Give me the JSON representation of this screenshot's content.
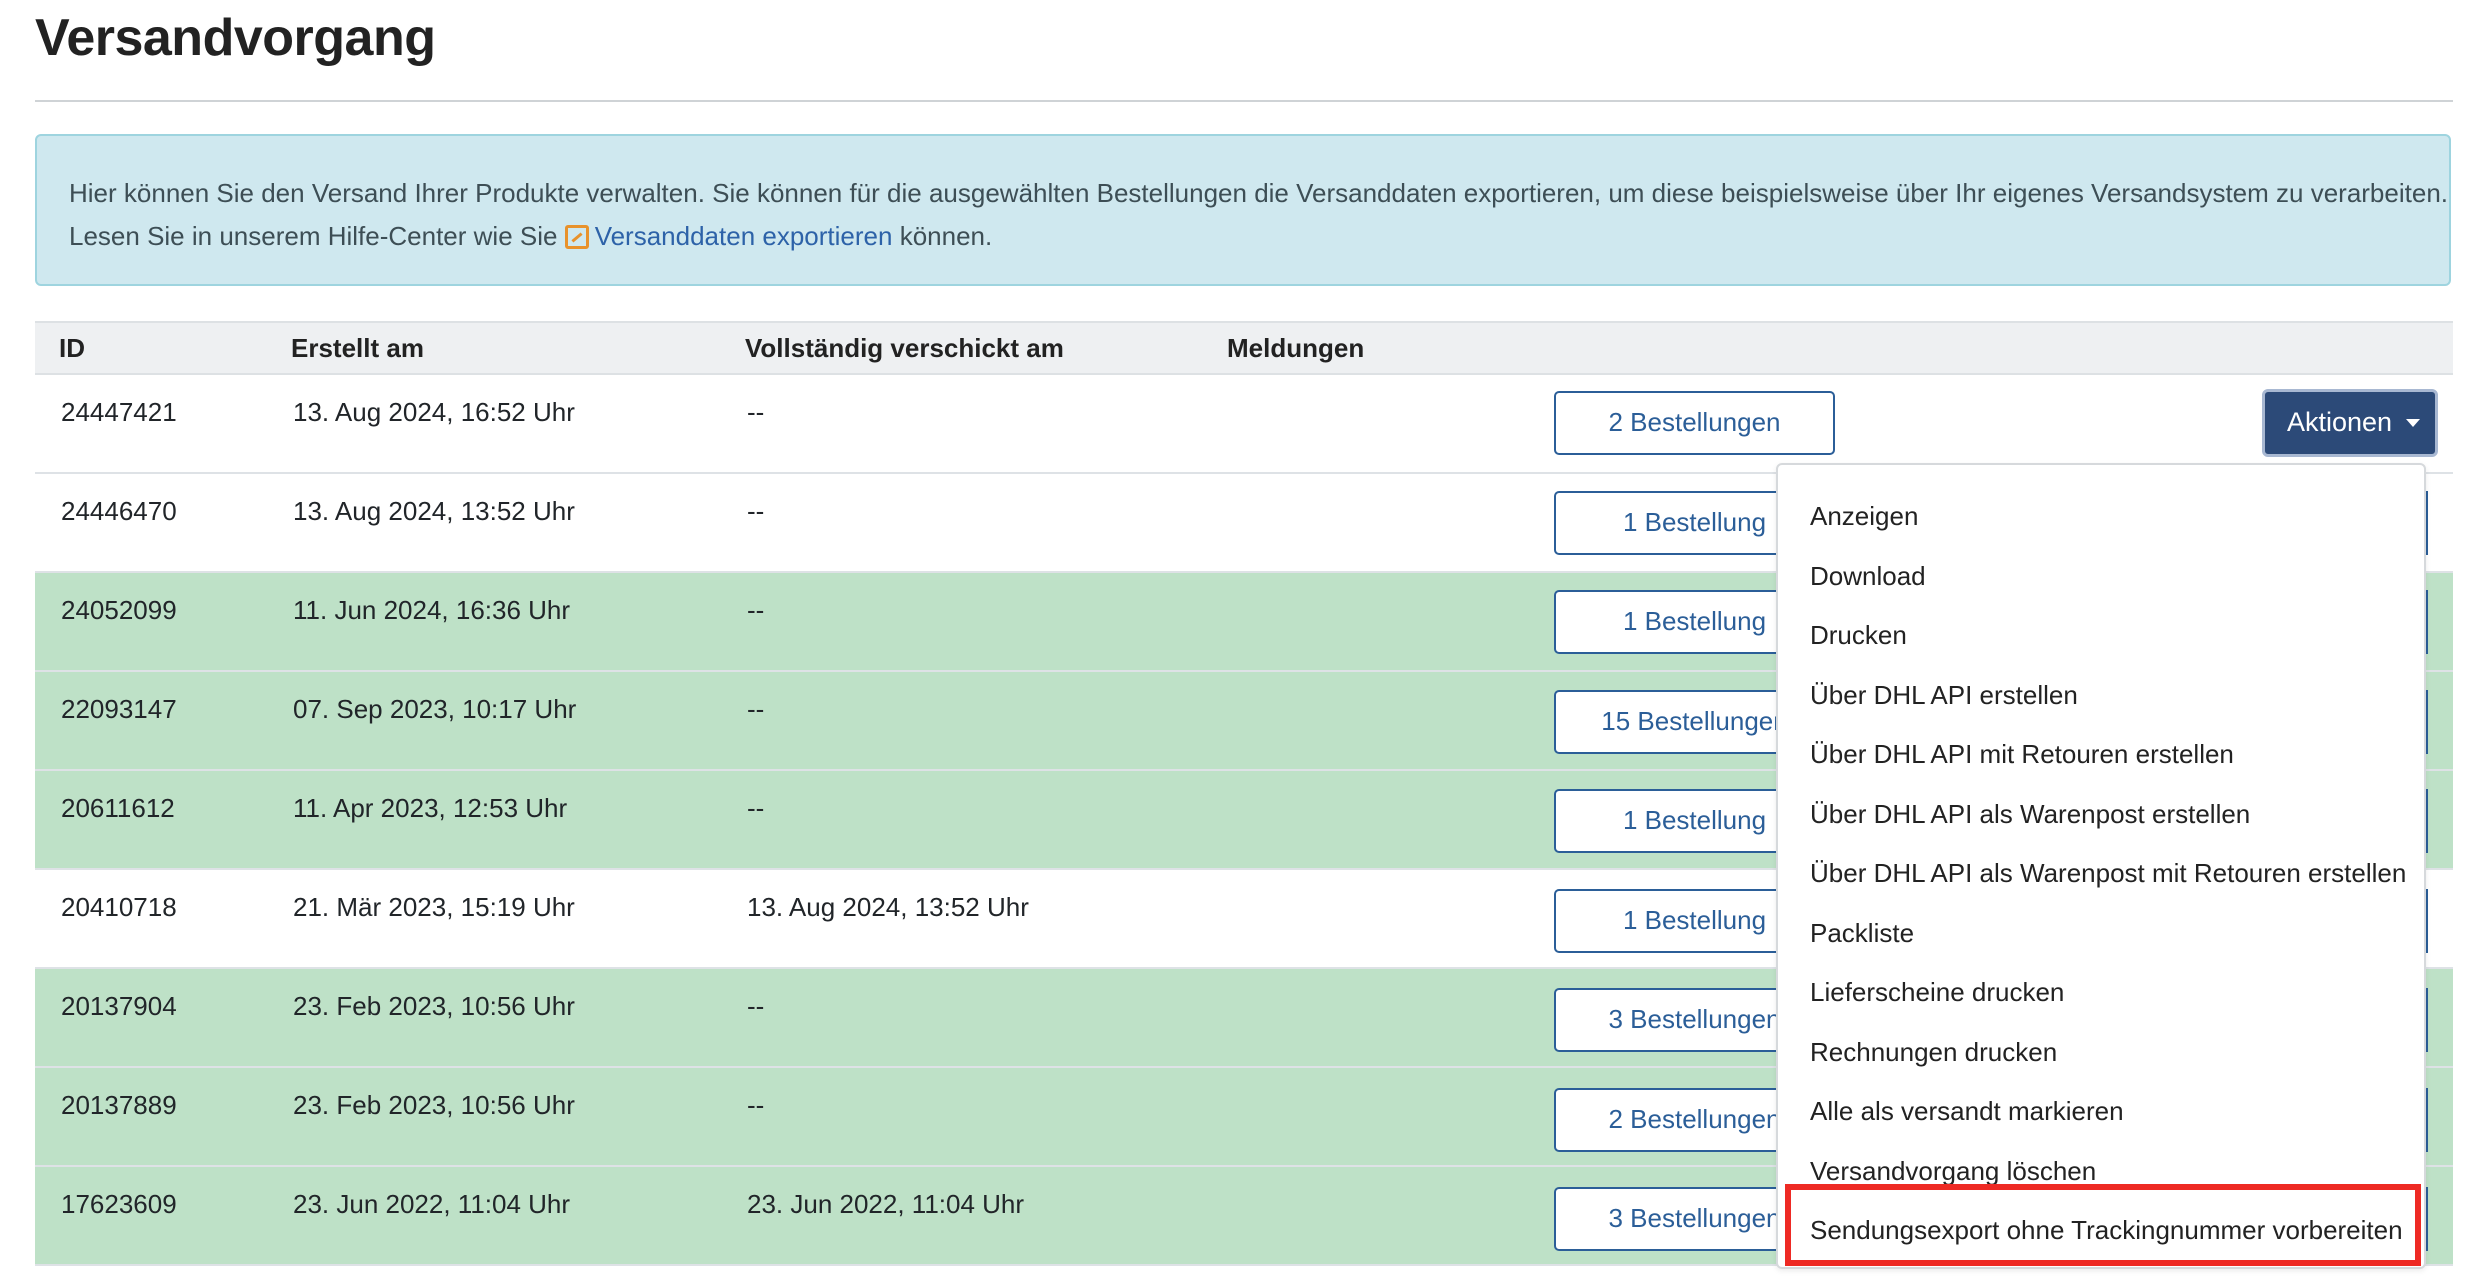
{
  "page_title": "Versandvorgang",
  "info": {
    "text_part1": "Hier können Sie den Versand Ihrer Produkte verwalten. Sie können für die ausgewählten Bestellungen die Versanddaten exportieren, um diese beispielsweise über Ihr eigenes Versandsystem zu verarbeiten.",
    "text_part2_prefix": "Lesen Sie in unserem Hilfe-Center wie Sie",
    "link_label": "Versanddaten exportieren",
    "text_part2_suffix": "können.",
    "link_icon": "export-icon"
  },
  "table": {
    "headers": [
      "ID",
      "Erstellt am",
      "Vollständig verschickt am",
      "Meldungen"
    ],
    "rows": [
      {
        "id": "24447421",
        "created": "13. Aug 2024, 16:52 Uhr",
        "shipped": "--",
        "orders": "2 Bestellungen",
        "highlight": false
      },
      {
        "id": "24446470",
        "created": "13. Aug 2024, 13:52 Uhr",
        "shipped": "--",
        "orders": "1 Bestellung",
        "highlight": false
      },
      {
        "id": "24052099",
        "created": "11. Jun 2024, 16:36 Uhr",
        "shipped": "--",
        "orders": "1 Bestellung",
        "highlight": true
      },
      {
        "id": "22093147",
        "created": "07. Sep 2023, 10:17 Uhr",
        "shipped": "--",
        "orders": "15 Bestellungen",
        "highlight": true
      },
      {
        "id": "20611612",
        "created": "11. Apr 2023, 12:53 Uhr",
        "shipped": "--",
        "orders": "1 Bestellung",
        "highlight": true
      },
      {
        "id": "20410718",
        "created": "21. Mär 2023, 15:19 Uhr",
        "shipped": "13. Aug 2024, 13:52 Uhr",
        "orders": "1 Bestellung",
        "highlight": false
      },
      {
        "id": "20137904",
        "created": "23. Feb 2023, 10:56 Uhr",
        "shipped": "--",
        "orders": "3 Bestellungen",
        "highlight": true
      },
      {
        "id": "20137889",
        "created": "23. Feb 2023, 10:56 Uhr",
        "shipped": "--",
        "orders": "2 Bestellungen",
        "highlight": true
      },
      {
        "id": "17623609",
        "created": "23. Jun 2022, 11:04 Uhr",
        "shipped": "23. Jun 2022, 11:04 Uhr",
        "orders": "3 Bestellungen",
        "highlight": true
      }
    ]
  },
  "actions_button": "Aktionen",
  "dropdown_items": [
    "Anzeigen",
    "Download",
    "Drucken",
    "Über DHL API erstellen",
    "Über DHL API mit Retouren erstellen",
    "Über DHL API als Warenpost erstellen",
    "Über DHL API als Warenpost mit Retouren erstellen",
    "Packliste",
    "Lieferscheine drucken",
    "Rechnungen drucken",
    "Alle als versandt markieren",
    "Versandvorgang löschen",
    "Sendungsexport ohne Trackingnummer vorbereiten"
  ],
  "colors": {
    "info_bg": "#cfe8ef",
    "row_highlight": "#bee1c7",
    "primary": "#2c4a78",
    "link": "#2d62a8",
    "annotation": "#ee2a24"
  }
}
